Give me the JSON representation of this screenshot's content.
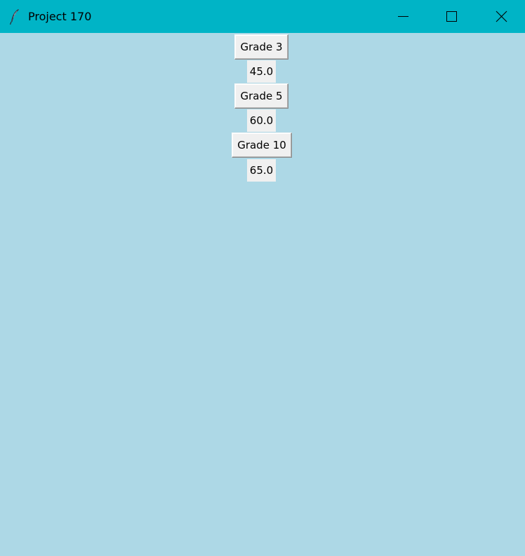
{
  "window": {
    "title": "Project 170",
    "app_icon": "feather-icon",
    "controls": {
      "minimize_icon": "minimize-icon",
      "maximize_icon": "maximize-icon",
      "close_icon": "close-icon"
    }
  },
  "colors": {
    "titlebar": "#00b4c6",
    "background": "#add8e6",
    "widget": "#f0f0f0"
  },
  "grades": [
    {
      "button_label": "Grade 3",
      "value": "45.0"
    },
    {
      "button_label": "Grade 5",
      "value": "60.0"
    },
    {
      "button_label": "Grade 10",
      "value": "65.0"
    }
  ]
}
